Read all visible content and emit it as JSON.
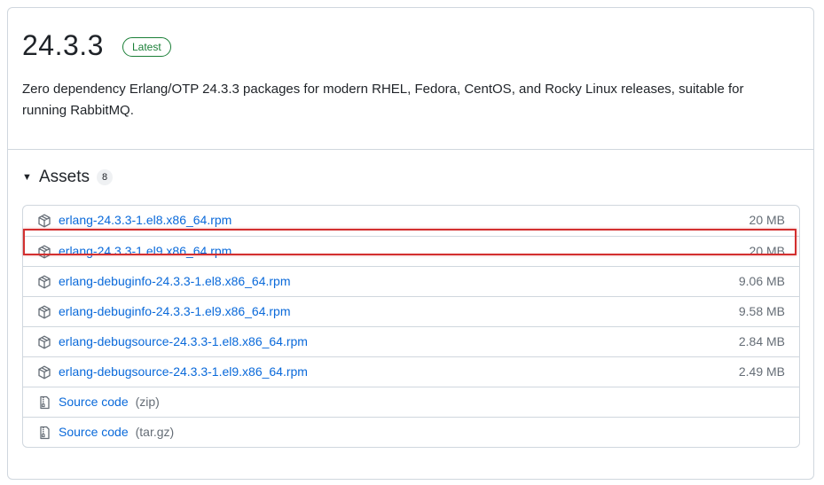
{
  "release": {
    "version": "24.3.3",
    "badge": "Latest",
    "description": "Zero dependency Erlang/OTP 24.3.3 packages for modern RHEL, Fedora, CentOS, and Rocky Linux releases, suitable for running RabbitMQ."
  },
  "assets": {
    "title": "Assets",
    "count": "8",
    "highlight_color": "#d32f2f",
    "items": [
      {
        "name": "erlang-24.3.3-1.el8.x86_64.rpm",
        "size": "20 MB",
        "icon": "package-icon"
      },
      {
        "name": "erlang-24.3.3-1.el9.x86_64.rpm",
        "size": "20 MB",
        "icon": "package-icon"
      },
      {
        "name": "erlang-debuginfo-24.3.3-1.el8.x86_64.rpm",
        "size": "9.06 MB",
        "icon": "package-icon"
      },
      {
        "name": "erlang-debuginfo-24.3.3-1.el9.x86_64.rpm",
        "size": "9.58 MB",
        "icon": "package-icon"
      },
      {
        "name": "erlang-debugsource-24.3.3-1.el8.x86_64.rpm",
        "size": "2.84 MB",
        "icon": "package-icon"
      },
      {
        "name": "erlang-debugsource-24.3.3-1.el9.x86_64.rpm",
        "size": "2.49 MB",
        "icon": "package-icon"
      },
      {
        "name": "Source code",
        "suffix": "(zip)",
        "icon": "file-zip-icon"
      },
      {
        "name": "Source code",
        "suffix": "(tar.gz)",
        "icon": "file-zip-icon"
      }
    ]
  }
}
